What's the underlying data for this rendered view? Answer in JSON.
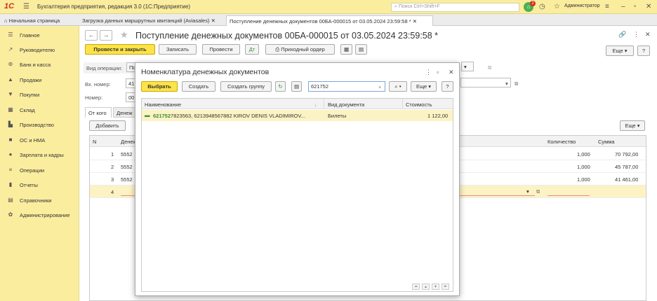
{
  "topbar": {
    "logo": "1С",
    "title": "Бухгалтерия предприятия, редакция 3.0  (1С:Предприятие)",
    "search_placeholder": "Поиск Ctrl+Shift+F",
    "notif_count": "2",
    "user": "Администратор"
  },
  "tabs": [
    {
      "label": "Начальная страница"
    },
    {
      "label": "Загрузка данных маршрутных квитанций (Aviasales)"
    },
    {
      "label": "Поступление денежных документов 00БА-000015 от 03.05.2024 23:59:58 *"
    }
  ],
  "sidebar": {
    "items": [
      {
        "label": "Главное",
        "icon": "☰"
      },
      {
        "label": "Руководителю",
        "icon": "↗"
      },
      {
        "label": "Банк и касса",
        "icon": "⊚"
      },
      {
        "label": "Продажи",
        "icon": "▲"
      },
      {
        "label": "Покупки",
        "icon": "▼"
      },
      {
        "label": "Склад",
        "icon": "▦"
      },
      {
        "label": "Производство",
        "icon": "▙"
      },
      {
        "label": "ОС и НМА",
        "icon": "■"
      },
      {
        "label": "Зарплата и кадры",
        "icon": "●"
      },
      {
        "label": "Операции",
        "icon": "≡"
      },
      {
        "label": "Отчеты",
        "icon": "▮"
      },
      {
        "label": "Справочники",
        "icon": "▤"
      },
      {
        "label": "Администрирование",
        "icon": "✿"
      }
    ]
  },
  "doc": {
    "title": "Поступление денежных документов 00БА-000015 от 03.05.2024 23:59:58 *",
    "btn_post_close": "Провести и закрыть",
    "btn_save": "Записать",
    "btn_post": "Провести",
    "btn_order": "Приходный ордер",
    "btn_more": "Еще",
    "btn_help": "?",
    "op_label": "Вид операции:",
    "op_value": "По",
    "in_num_label": "Вх. номер:",
    "in_num_value": "41",
    "num_label": "Номер:",
    "num_value": "00",
    "tab_from": "От кого",
    "tab_docs": "Денеж",
    "btn_add": "Добавить",
    "grid_headers": {
      "n": "N",
      "doc": "Денеж",
      "qty": "Количество",
      "sum": "Сумма"
    },
    "rows": [
      {
        "n": "1",
        "doc": "5552",
        "qty": "1,000",
        "sum": "70 792,00"
      },
      {
        "n": "2",
        "doc": "5552",
        "qty": "1,000",
        "sum": "45 787,00"
      },
      {
        "n": "3",
        "doc": "5552",
        "qty": "1,000",
        "sum": "41 461,00"
      },
      {
        "n": "4",
        "doc": "",
        "qty": "",
        "sum": ""
      }
    ]
  },
  "modal": {
    "title": "Номенклатура денежных документов",
    "btn_select": "Выбрать",
    "btn_create": "Создать",
    "btn_create_group": "Создать группу",
    "search_value": "621752",
    "btn_more": "Еще",
    "btn_help": "?",
    "headers": {
      "name": "Наименование",
      "type": "Вид документа",
      "cost": "Стоимость"
    },
    "row": {
      "name_highlight": "621752",
      "name_rest": "7823563, 6213948567882 KIROV DENIS VLADIMIROV...",
      "type": "Билеты",
      "cost": "1 122,00"
    }
  }
}
